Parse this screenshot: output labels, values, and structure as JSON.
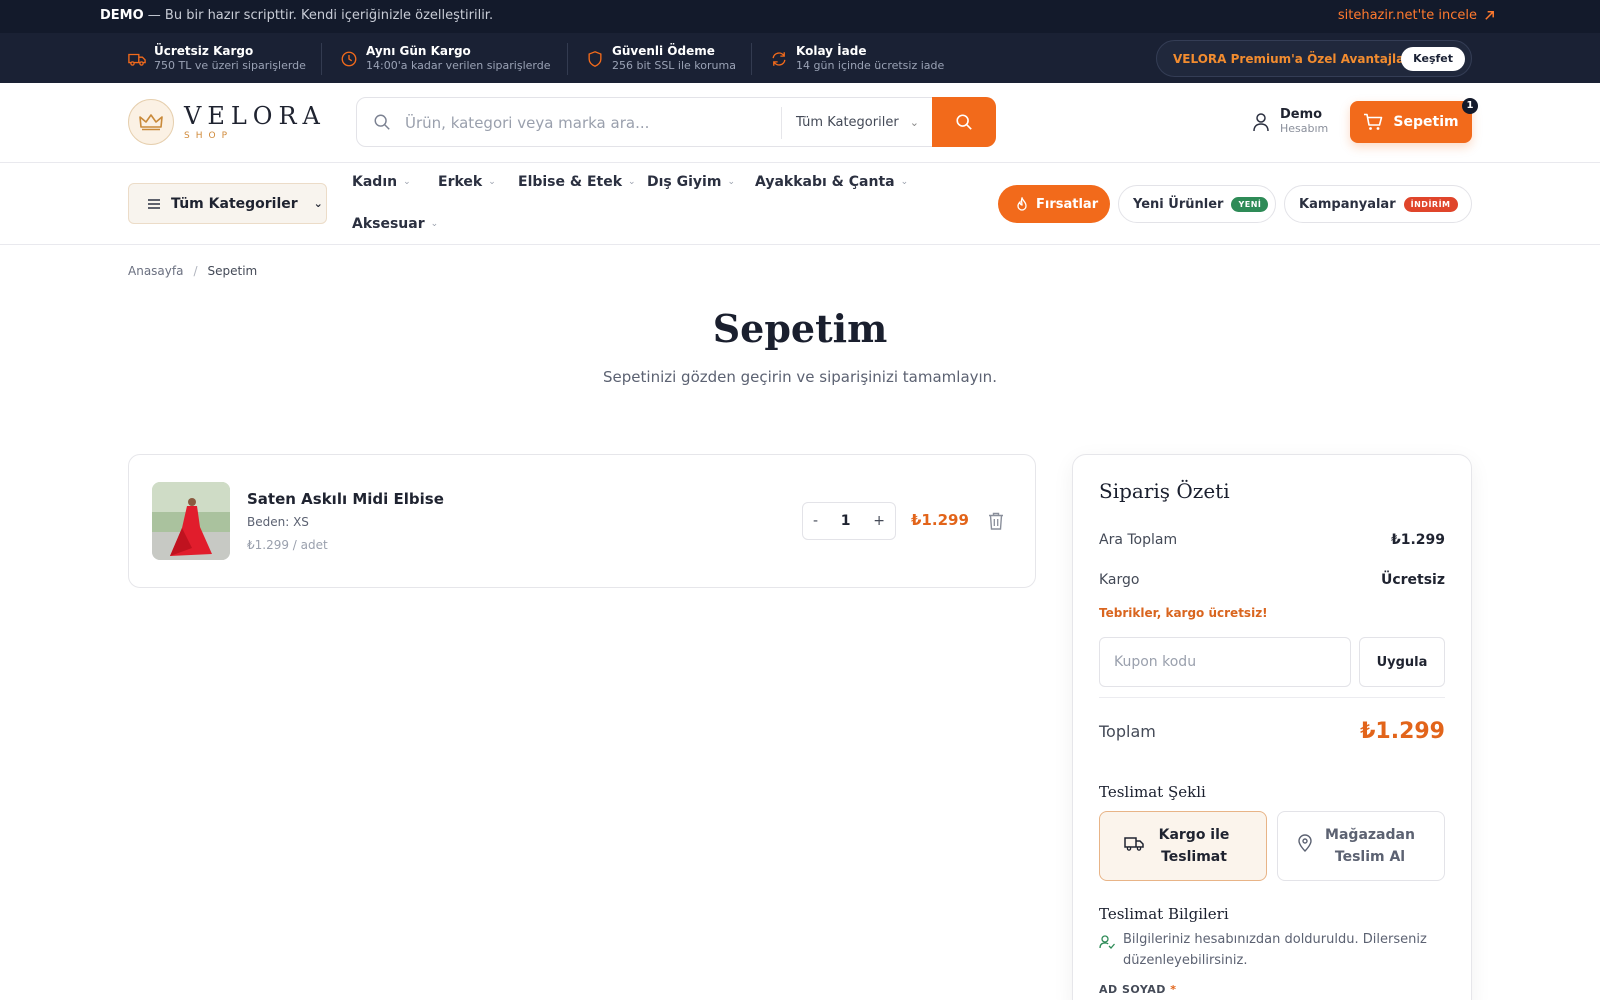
{
  "demo_bar": {
    "badge": "DEMO",
    "text": " — Bu bir hazır scripttir. Kendi içeriğinizle özelleştirilir.",
    "link": "sitehazir.net'te incele"
  },
  "features": [
    {
      "title": "Ücretsiz Kargo",
      "subtitle": "750 TL ve üzeri siparişlerde",
      "icon": "truck-icon"
    },
    {
      "title": "Aynı Gün Kargo",
      "subtitle": "14:00'a kadar verilen siparişlerde",
      "icon": "clock-icon"
    },
    {
      "title": "Güvenli Ödeme",
      "subtitle": "256 bit SSL ile koruma",
      "icon": "shield-icon"
    },
    {
      "title": "Kolay İade",
      "subtitle": "14 gün içinde ücretsiz iade",
      "icon": "refresh-icon"
    }
  ],
  "premium": {
    "label": "VELORA Premium'a Özel Avantajlar",
    "button": "Keşfet"
  },
  "header": {
    "logo_name": "VELORA",
    "logo_sub": "SHOP",
    "search_placeholder": "Ürün, kategori veya marka ara...",
    "category_select": "Tüm Kategoriler",
    "account_name": "Demo",
    "account_sub": "Hesabım",
    "cart_label": "Sepetim",
    "cart_count": "1"
  },
  "nav": {
    "all_categories": "Tüm Kategoriler",
    "items": [
      "Kadın",
      "Erkek",
      "Elbise & Etek",
      "Dış Giyim",
      "Ayakkabı & Çanta",
      "Aksesuar"
    ],
    "deals": "Fırsatlar",
    "new_products": "Yeni Ürünler",
    "new_tag": "YENİ",
    "campaigns": "Kampanyalar",
    "discount_tag": "İNDİRİM",
    "colors": {
      "accent": "#f26a1b",
      "new_tag": "#2e8b57",
      "discount_tag": "#e0452b"
    }
  },
  "breadcrumb": {
    "home": "Anasayfa",
    "separator": "/",
    "current": "Sepetim"
  },
  "page": {
    "title": "Sepetim",
    "subtitle": "Sepetinizi gözden geçirin ve siparişinizi tamamlayın."
  },
  "cart_item": {
    "name": "Saten Askılı Midi Elbise",
    "size": "Beden: XS",
    "unit_price": "₺1.299 / adet",
    "quantity": "1",
    "minus": "-",
    "plus": "+",
    "total": "₺1.299"
  },
  "summary": {
    "title": "Sipariş Özeti",
    "subtotal_label": "Ara Toplam",
    "subtotal_value": "₺1.299",
    "shipping_label": "Kargo",
    "shipping_value": "Ücretsiz",
    "free_shipping_note": "Tebrikler, kargo ücretsiz!",
    "coupon_placeholder": "Kupon kodu",
    "apply_label": "Uygula",
    "total_label": "Toplam",
    "total_value": "₺1.299",
    "delivery_title": "Teslimat Şekli",
    "delivery_options": [
      "Kargo ile Teslimat",
      "Mağazadan Teslim Al"
    ],
    "info_title": "Teslimat Bilgileri",
    "info_note": "Bilgileriniz hesabınızdan dolduruldu. Dilerseniz düzenleyebilirsiniz.",
    "name_label": "AD SOYAD",
    "required_mark": "*"
  }
}
